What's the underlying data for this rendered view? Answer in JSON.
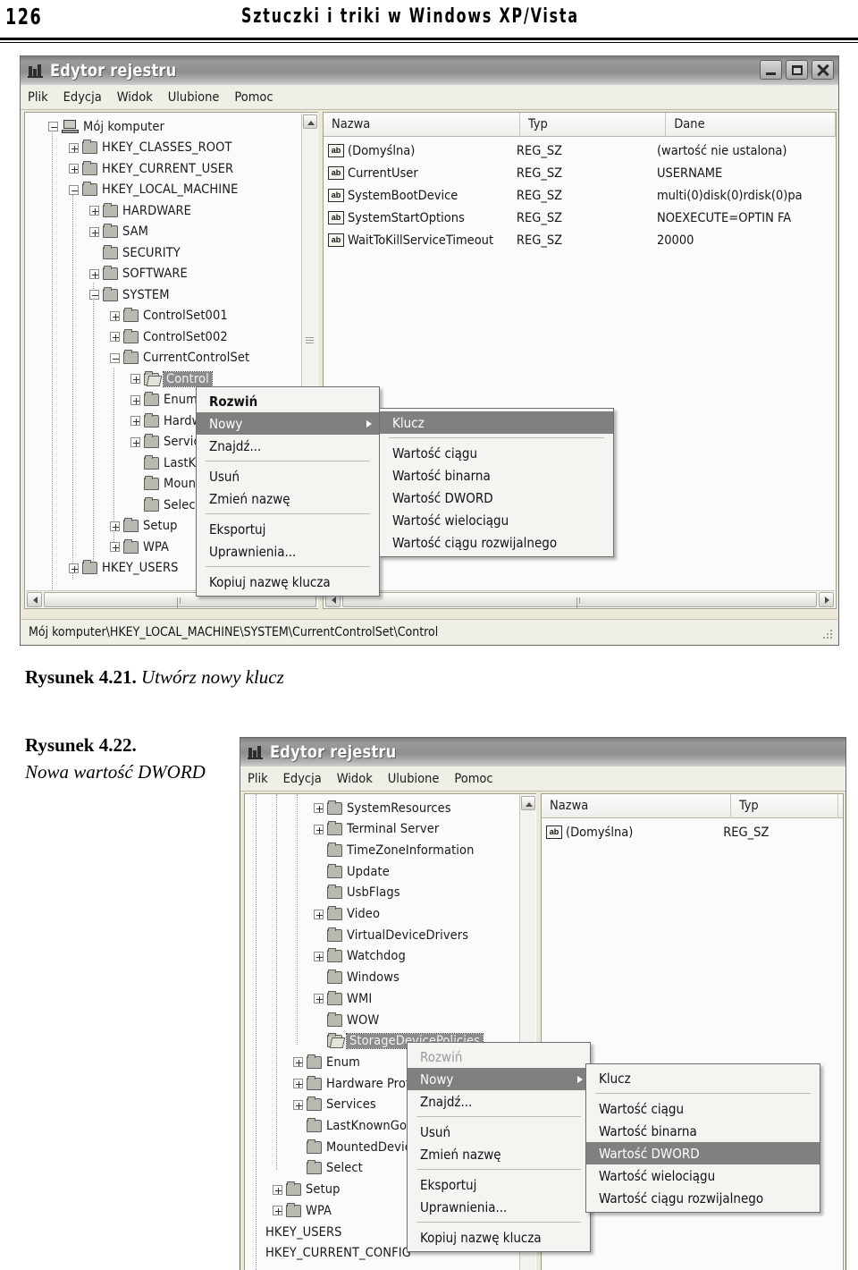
{
  "running_head": {
    "page_number": "126",
    "title": "Sztuczki i triki w Windows XP/Vista"
  },
  "figures": [
    {
      "caption_number": "Rysunek 4.21.",
      "caption_text": "Utwórz nowy klucz"
    },
    {
      "caption_number": "Rysunek 4.22.",
      "caption_text": "Nowa wartość DWORD"
    }
  ],
  "window1": {
    "title": "Edytor rejestru",
    "title_icon": "registry-editor-icon",
    "window_buttons": [
      {
        "name": "minimize",
        "glyph": "_"
      },
      {
        "name": "maximize",
        "glyph": "□"
      },
      {
        "name": "close",
        "glyph": "✕"
      }
    ],
    "menu": [
      "Plik",
      "Edycja",
      "Widok",
      "Ulubione",
      "Pomoc"
    ],
    "tree": [
      {
        "label": "Mój komputer",
        "indent": 0,
        "toggle": "minus",
        "icon": "computer"
      },
      {
        "label": "HKEY_CLASSES_ROOT",
        "indent": 1,
        "toggle": "plus",
        "icon": "folder"
      },
      {
        "label": "HKEY_CURRENT_USER",
        "indent": 1,
        "toggle": "plus",
        "icon": "folder"
      },
      {
        "label": "HKEY_LOCAL_MACHINE",
        "indent": 1,
        "toggle": "minus",
        "icon": "folder"
      },
      {
        "label": "HARDWARE",
        "indent": 2,
        "toggle": "plus",
        "icon": "folder"
      },
      {
        "label": "SAM",
        "indent": 2,
        "toggle": "plus",
        "icon": "folder"
      },
      {
        "label": "SECURITY",
        "indent": 2,
        "toggle": "none",
        "icon": "folder"
      },
      {
        "label": "SOFTWARE",
        "indent": 2,
        "toggle": "plus",
        "icon": "folder"
      },
      {
        "label": "SYSTEM",
        "indent": 2,
        "toggle": "minus",
        "icon": "folder"
      },
      {
        "label": "ControlSet001",
        "indent": 3,
        "toggle": "plus",
        "icon": "folder"
      },
      {
        "label": "ControlSet002",
        "indent": 3,
        "toggle": "plus",
        "icon": "folder"
      },
      {
        "label": "CurrentControlSet",
        "indent": 3,
        "toggle": "minus",
        "icon": "folder"
      },
      {
        "label": "Control",
        "indent": 4,
        "toggle": "plus",
        "icon": "folder-open",
        "selected": true
      },
      {
        "label": "Enum",
        "indent": 4,
        "toggle": "plus",
        "icon": "folder"
      },
      {
        "label": "Hardware Profiles",
        "indent": 4,
        "toggle": "plus",
        "icon": "folder"
      },
      {
        "label": "Services",
        "indent": 4,
        "toggle": "plus",
        "icon": "folder"
      },
      {
        "label": "LastKnownGoodRecovery",
        "indent": 4,
        "toggle": "none",
        "icon": "folder"
      },
      {
        "label": "MountedDevices",
        "indent": 4,
        "toggle": "none",
        "icon": "folder"
      },
      {
        "label": "Select",
        "indent": 4,
        "toggle": "none",
        "icon": "folder"
      },
      {
        "label": "Setup",
        "indent": 3,
        "toggle": "plus",
        "icon": "folder"
      },
      {
        "label": "WPA",
        "indent": 3,
        "toggle": "plus",
        "icon": "folder"
      },
      {
        "label": "HKEY_USERS",
        "indent": 1,
        "toggle": "plus",
        "icon": "folder"
      }
    ],
    "list_headers": [
      "Nazwa",
      "Typ",
      "Dane"
    ],
    "list_rows": [
      {
        "name": "(Domyślna)",
        "type": "REG_SZ",
        "data": "(wartość nie ustalona)"
      },
      {
        "name": "CurrentUser",
        "type": "REG_SZ",
        "data": "USERNAME"
      },
      {
        "name": "SystemBootDevice",
        "type": "REG_SZ",
        "data": "multi(0)disk(0)rdisk(0)pa"
      },
      {
        "name": "SystemStartOptions",
        "type": "REG_SZ",
        "data": "NOEXECUTE=OPTIN FA"
      },
      {
        "name": "WaitToKillServiceTimeout",
        "type": "REG_SZ",
        "data": "20000"
      }
    ],
    "status_path": "Mój komputer\\HKEY_LOCAL_MACHINE\\SYSTEM\\CurrentControlSet\\Control",
    "context_menu": [
      {
        "label": "Rozwiń",
        "style": "bold"
      },
      {
        "label": "Nowy",
        "style": "highlight",
        "submenu": true
      },
      {
        "label": "Znajdź...",
        "style": "normal"
      },
      {
        "separator": true
      },
      {
        "label": "Usuń",
        "style": "normal"
      },
      {
        "label": "Zmień nazwę",
        "style": "normal"
      },
      {
        "separator": true
      },
      {
        "label": "Eksportuj",
        "style": "normal"
      },
      {
        "label": "Uprawnienia...",
        "style": "normal"
      },
      {
        "separator": true
      },
      {
        "label": "Kopiuj nazwę klucza",
        "style": "normal"
      }
    ],
    "submenu": [
      {
        "label": "Klucz",
        "style": "highlight"
      },
      {
        "separator": true
      },
      {
        "label": "Wartość ciągu",
        "style": "normal"
      },
      {
        "label": "Wartość binarna",
        "style": "normal"
      },
      {
        "label": "Wartość DWORD",
        "style": "normal"
      },
      {
        "label": "Wartość wielociągu",
        "style": "normal"
      },
      {
        "label": "Wartość ciągu rozwijalnego",
        "style": "normal"
      }
    ]
  },
  "window2": {
    "title": "Edytor rejestru",
    "title_icon": "registry-editor-icon",
    "menu": [
      "Plik",
      "Edycja",
      "Widok",
      "Ulubione",
      "Pomoc"
    ],
    "tree": [
      {
        "label": "SystemResources",
        "indent": 1,
        "toggle": "plus",
        "icon": "folder"
      },
      {
        "label": "Terminal Server",
        "indent": 1,
        "toggle": "plus",
        "icon": "folder"
      },
      {
        "label": "TimeZoneInformation",
        "indent": 1,
        "toggle": "none",
        "icon": "folder"
      },
      {
        "label": "Update",
        "indent": 1,
        "toggle": "none",
        "icon": "folder"
      },
      {
        "label": "UsbFlags",
        "indent": 1,
        "toggle": "none",
        "icon": "folder"
      },
      {
        "label": "Video",
        "indent": 1,
        "toggle": "plus",
        "icon": "folder"
      },
      {
        "label": "VirtualDeviceDrivers",
        "indent": 1,
        "toggle": "none",
        "icon": "folder"
      },
      {
        "label": "Watchdog",
        "indent": 1,
        "toggle": "plus",
        "icon": "folder"
      },
      {
        "label": "Windows",
        "indent": 1,
        "toggle": "none",
        "icon": "folder"
      },
      {
        "label": "WMI",
        "indent": 1,
        "toggle": "plus",
        "icon": "folder"
      },
      {
        "label": "WOW",
        "indent": 1,
        "toggle": "none",
        "icon": "folder"
      },
      {
        "label": "StorageDevicePolicies",
        "indent": 1,
        "toggle": "none",
        "icon": "folder-open",
        "selected": true
      },
      {
        "label": "Enum",
        "indent": 0,
        "toggle": "plus",
        "icon": "folder"
      },
      {
        "label": "Hardware Profiles",
        "indent": 0,
        "toggle": "plus",
        "icon": "folder"
      },
      {
        "label": "Services",
        "indent": 0,
        "toggle": "plus",
        "icon": "folder"
      },
      {
        "label": "LastKnownGoodRecovery",
        "indent": 0,
        "toggle": "none",
        "icon": "folder"
      },
      {
        "label": "MountedDevices",
        "indent": 0,
        "toggle": "none",
        "icon": "folder"
      },
      {
        "label": "Select",
        "indent": 0,
        "toggle": "none",
        "icon": "folder"
      },
      {
        "label": "Setup",
        "indent": -1,
        "toggle": "plus",
        "icon": "folder"
      },
      {
        "label": "WPA",
        "indent": -1,
        "toggle": "plus",
        "icon": "folder"
      },
      {
        "label": "HKEY_USERS",
        "indent": -2,
        "toggle": "none",
        "icon": "none"
      },
      {
        "label": "HKEY_CURRENT_CONFIG",
        "indent": -2,
        "toggle": "none",
        "icon": "none"
      }
    ],
    "list_headers": [
      "Nazwa",
      "Typ"
    ],
    "list_rows": [
      {
        "name": "(Domyślna)",
        "type": "REG_SZ"
      }
    ],
    "context_menu": [
      {
        "label": "Rozwiń",
        "style": "disabled"
      },
      {
        "label": "Nowy",
        "style": "highlight",
        "submenu": true
      },
      {
        "label": "Znajdź...",
        "style": "normal"
      },
      {
        "separator": true
      },
      {
        "label": "Usuń",
        "style": "normal"
      },
      {
        "label": "Zmień nazwę",
        "style": "normal"
      },
      {
        "separator": true
      },
      {
        "label": "Eksportuj",
        "style": "normal"
      },
      {
        "label": "Uprawnienia...",
        "style": "normal"
      },
      {
        "separator": true
      },
      {
        "label": "Kopiuj nazwę klucza",
        "style": "normal"
      }
    ],
    "submenu": [
      {
        "label": "Klucz",
        "style": "normal"
      },
      {
        "separator": true
      },
      {
        "label": "Wartość ciągu",
        "style": "normal"
      },
      {
        "label": "Wartość binarna",
        "style": "normal"
      },
      {
        "label": "Wartość DWORD",
        "style": "highlight"
      },
      {
        "label": "Wartość wielociągu",
        "style": "normal"
      },
      {
        "label": "Wartość ciągu rozwijalnego",
        "style": "normal"
      }
    ]
  },
  "colors": {
    "highlight": "#808080",
    "window_face": "#ece9d8",
    "pane": "#fbfbfb"
  }
}
